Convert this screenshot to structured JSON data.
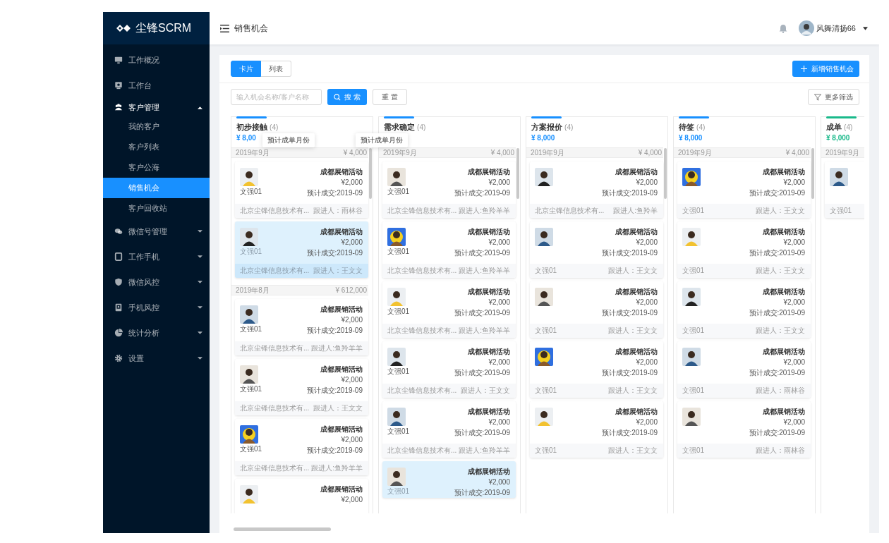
{
  "sidebar": {
    "logo": "尘锋SCRM",
    "items": [
      {
        "label": "工作概况",
        "selected": false
      },
      {
        "label": "工作台",
        "selected": false
      },
      {
        "label": "客户管理",
        "selected": false,
        "expanded": true,
        "children": [
          {
            "label": "我的客户",
            "selected": false
          },
          {
            "label": "客户列表",
            "selected": false
          },
          {
            "label": "客户公海",
            "selected": false
          },
          {
            "label": "销售机会",
            "selected": true
          },
          {
            "label": "客户回收站",
            "selected": false
          }
        ]
      },
      {
        "label": "微信号管理",
        "selected": false,
        "expanded": false
      },
      {
        "label": "工作手机",
        "selected": false,
        "expanded": false
      },
      {
        "label": "微信风控",
        "selected": false,
        "expanded": false
      },
      {
        "label": "手机风控",
        "selected": false,
        "expanded": false
      },
      {
        "label": "统计分析",
        "selected": false,
        "expanded": false
      },
      {
        "label": "设置",
        "selected": false,
        "expanded": false
      }
    ]
  },
  "header": {
    "title": "销售机会",
    "user": "风舞清扬66"
  },
  "view_tabs": [
    {
      "label": "卡片",
      "selected": true
    },
    {
      "label": "列表",
      "selected": false
    }
  ],
  "new_button": "新增销售机会",
  "filters": {
    "search": {
      "placeholder": "输入机会名称/客户名称"
    },
    "search_button": "搜 索",
    "reset_button": "重 置",
    "more_button": "更多筛选"
  },
  "board": {
    "columns": [
      {
        "title": "初步接触",
        "count": "(4)",
        "amount": "¥ 8,00",
        "color": "#1890ff",
        "tooltip": "预计成单月份",
        "groups": [
          {
            "month": "2019年9月",
            "total": "¥ 4,000",
            "cards": [
              {
                "title": "成都展销活动",
                "amount": "¥2,000",
                "expected": "预计成交:2019-09",
                "contact": "文强01",
                "footer_left": "北京尘锋信息技术有...",
                "follower": "跟进人：雨林谷",
                "selected": false
              },
              {
                "title": "成都展销活动",
                "amount": "¥2,000",
                "expected": "预计成交:2019-09",
                "contact": "文强01",
                "footer_left": "北京尘锋信息技术有...",
                "follower": "跟进人：王文文",
                "selected": true
              }
            ]
          },
          {
            "month": "2019年8月",
            "total": "¥ 612,000",
            "cards": [
              {
                "title": "成都展销活动",
                "amount": "¥2,000",
                "expected": "预计成交:2019-09",
                "contact": "文强01",
                "footer_left": "北京尘锋信息技术有...",
                "follower": "跟进人:鱼羚羊羊",
                "selected": false
              },
              {
                "title": "成都展销活动",
                "amount": "¥2,000",
                "expected": "预计成交:2019-09",
                "contact": "文强01",
                "footer_left": "北京尘锋信息技术有...",
                "follower": "跟进人：王文文",
                "selected": false
              },
              {
                "title": "成都展销活动",
                "amount": "¥2,000",
                "expected": "预计成交:2019-09",
                "contact": "文强01",
                "footer_left": "北京尘锋信息技术有...",
                "follower": "跟进人:鱼羚羊羊",
                "selected": false
              },
              {
                "title": "成都展销活动",
                "amount": "¥2,000",
                "selected": false
              }
            ]
          }
        ]
      },
      {
        "title": "需求确定",
        "count": "(4)",
        "color": "#1890ff",
        "tooltip": "预计成单月份",
        "groups": [
          {
            "month": "2019年9月",
            "total": "¥ 4,000",
            "cards": [
              {
                "title": "成都展销活动",
                "amount": "¥2,000",
                "expected": "预计成交:2019-09",
                "contact": "文强01",
                "footer_left": "北京尘锋信息技术有...",
                "follower": "跟进人:鱼羚羊羊",
                "selected": false
              },
              {
                "title": "成都展销活动",
                "amount": "¥2,000",
                "expected": "预计成交:2019-09",
                "contact": "文强01",
                "footer_left": "北京尘锋信息技术有...",
                "follower": "跟进人:鱼羚羊羊",
                "selected": false
              },
              {
                "title": "成都展销活动",
                "amount": "¥2,000",
                "expected": "预计成交:2019-09",
                "contact": "文强01",
                "footer_left": "北京尘锋信息技术有...",
                "follower": "跟进人:鱼羚羊羊",
                "selected": false
              },
              {
                "title": "成都展销活动",
                "amount": "¥2,000",
                "expected": "预计成交:2019-09",
                "contact": "文强01",
                "footer_left": "北京尘锋信息技术有...",
                "follower": "跟进人：王文文",
                "selected": false
              },
              {
                "title": "成都展销活动",
                "amount": "¥2,000",
                "expected": "预计成交:2019-09",
                "contact": "文强01",
                "footer_left": "北京尘锋信息技术有...",
                "follower": "跟进人:鱼羚羊羊",
                "selected": false
              },
              {
                "title": "成都展销活动",
                "amount": "¥2,000",
                "expected": "预计成交:2019-09",
                "contact": "文强01",
                "selected": true
              }
            ]
          }
        ]
      },
      {
        "title": "方案报价",
        "count": "(4)",
        "amount": "¥ 8,000",
        "color": "#1890ff",
        "groups": [
          {
            "month": "2019年9月",
            "total": "¥ 4,000",
            "cards": [
              {
                "title": "成都展销活动",
                "amount": "¥2,000",
                "expected": "预计成交:2019-09",
                "footer_left": "北京尘锋信息技术有...",
                "follower": "跟进人:鱼羚羊",
                "selected": false
              },
              {
                "title": "成都展销活动",
                "amount": "¥2,000",
                "expected": "预计成交:2019-09",
                "footer_left": "文强01",
                "follower": "跟进人：王文文",
                "selected": false
              },
              {
                "title": "成都展销活动",
                "amount": "¥2,000",
                "expected": "预计成交:2019-09",
                "footer_left": "文强01",
                "follower": "跟进人：王文文",
                "selected": false
              },
              {
                "title": "成都展销活动",
                "amount": "¥2,000",
                "expected": "预计成交:2019-09",
                "footer_left": "文强01",
                "follower": "跟进人：王文文",
                "selected": false
              },
              {
                "title": "成都展销活动",
                "amount": "¥2,000",
                "expected": "预计成交:2019-09",
                "footer_left": "文强01",
                "follower": "跟进人：王文文",
                "selected": false
              }
            ]
          }
        ]
      },
      {
        "title": "待签",
        "count": "(4)",
        "amount": "¥ 8,000",
        "color": "#1890ff",
        "groups": [
          {
            "month": "2019年9月",
            "total": "¥ 4,000",
            "cards": [
              {
                "title": "成都展销活动",
                "amount": "¥2,000",
                "expected": "预计成交:2019-09",
                "footer_left": "文强01",
                "follower": "跟进人：王文文",
                "selected": false
              },
              {
                "title": "成都展销活动",
                "amount": "¥2,000",
                "expected": "预计成交:2019-09",
                "footer_left": "文强01",
                "follower": "跟进人：王文文",
                "selected": false
              },
              {
                "title": "成都展销活动",
                "amount": "¥2,000",
                "expected": "预计成交:2019-09",
                "footer_left": "文强01",
                "follower": "跟进人：王文文",
                "selected": false
              },
              {
                "title": "成都展销活动",
                "amount": "¥2,000",
                "expected": "预计成交:2019-09",
                "footer_left": "文强01",
                "follower": "跟进人：雨林谷",
                "selected": false
              },
              {
                "title": "成都展销活动",
                "amount": "¥2,000",
                "expected": "预计成交:2019-09",
                "footer_left": "文强01",
                "follower": "跟进人：雨林谷",
                "selected": false
              }
            ]
          }
        ]
      },
      {
        "title": "成单",
        "count": "(4)",
        "amount": "¥ 8,000",
        "color": "#19b98a",
        "groups": [
          {
            "month": "2019年9月",
            "cards": [
              {
                "footer_left": "文强01",
                "selected": false
              }
            ]
          }
        ]
      }
    ]
  }
}
